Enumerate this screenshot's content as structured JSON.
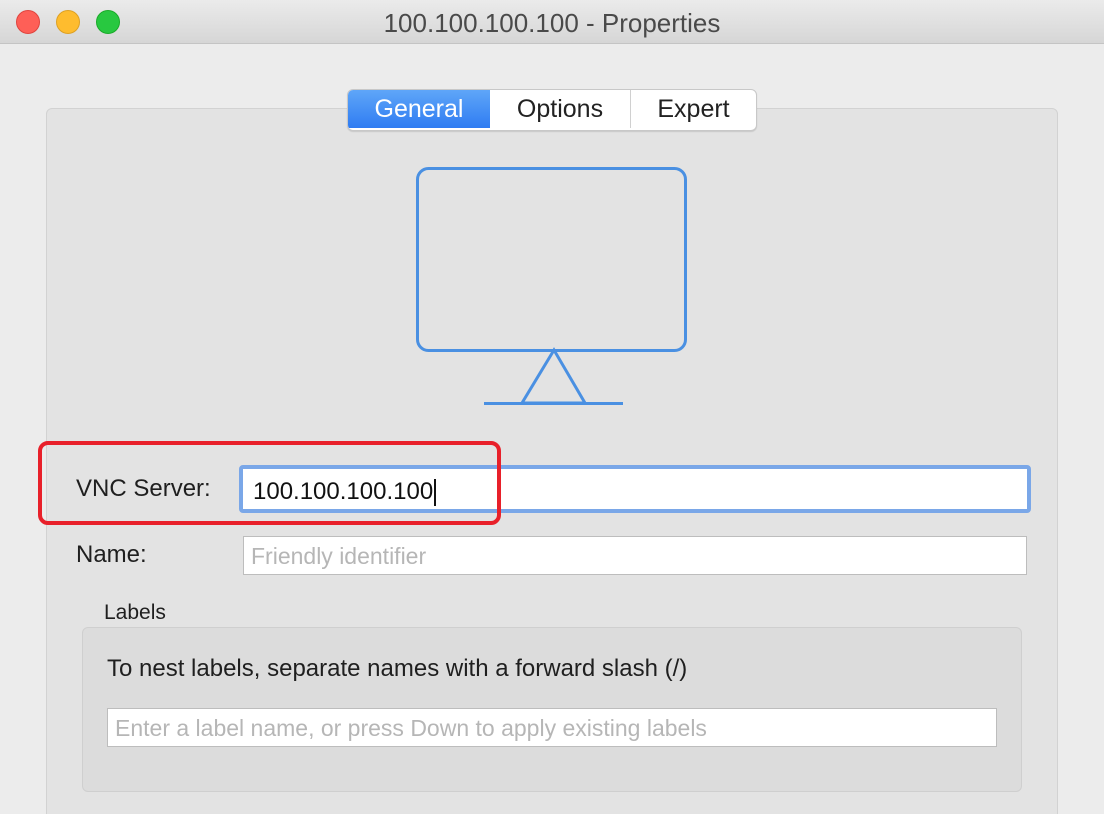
{
  "window": {
    "title": "100.100.100.100 - Properties"
  },
  "tabs": [
    {
      "label": "General",
      "selected": true
    },
    {
      "label": "Options",
      "selected": false
    },
    {
      "label": "Expert",
      "selected": false
    }
  ],
  "icon": {
    "name": "monitor-icon",
    "color": "#4a90e2"
  },
  "form": {
    "vnc_server_label": "VNC Server:",
    "vnc_server_value": "100.100.100.100",
    "name_label": "Name:",
    "name_placeholder": "Friendly identifier"
  },
  "labels": {
    "group_title": "Labels",
    "hint": "To nest labels, separate names with a forward slash (/)",
    "input_placeholder": "Enter a label name, or press Down to apply existing labels"
  },
  "annotation": {
    "highlight_color": "#e8202a"
  }
}
